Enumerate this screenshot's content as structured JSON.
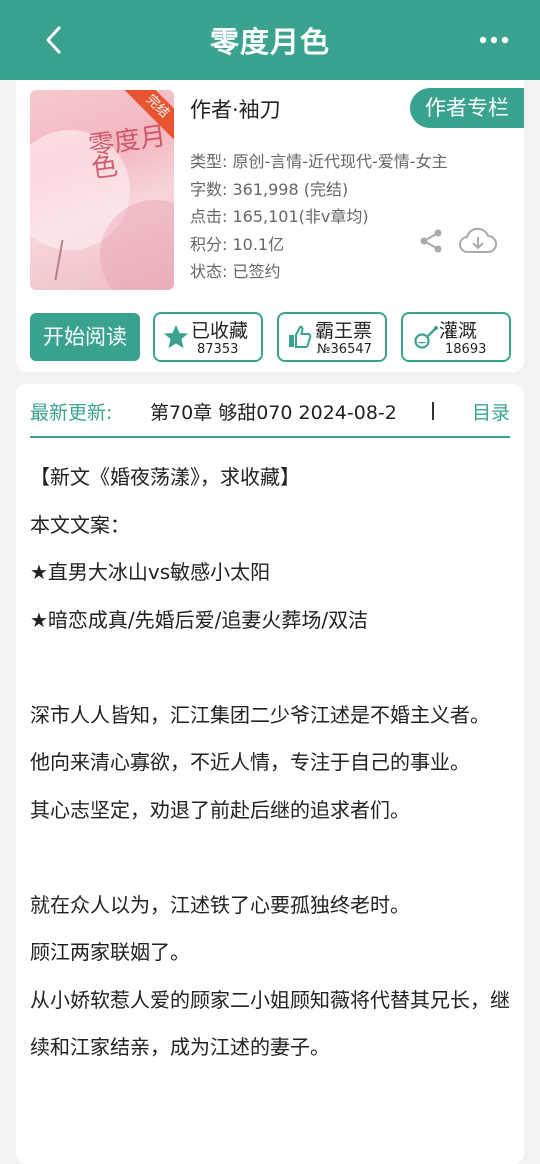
{
  "header": {
    "title": "零度月色",
    "back_icon": "chevron-left-icon",
    "more_icon": "more-horizontal-icon"
  },
  "book": {
    "cover_title_art": "零度月色",
    "status_badge": "完结",
    "author_line": "作者·袖刀",
    "author_column_button": "作者专栏",
    "info": {
      "type": "类型: 原创-言情-近代现代-爱情-女主",
      "words": "字数: 361,998 (完结)",
      "clicks": "点击: 165,101(非v章均)",
      "points": "积分: 10.1亿",
      "status": "状态: 已签约"
    },
    "share_icon": "share-icon",
    "download_icon": "cloud-download-icon"
  },
  "actions": {
    "read": "开始阅读",
    "favorite": {
      "label": "已收藏",
      "count": "87353",
      "icon": "star-icon"
    },
    "ticket": {
      "label": "霸王票",
      "count": "№36547",
      "icon": "thumbs-up-icon"
    },
    "water": {
      "label": "灌溉",
      "count": "18693",
      "icon": "watering-can-icon"
    }
  },
  "latest": {
    "label": "最新更新:",
    "chapter": "第70章  够甜070  2024-08-2",
    "toc": "目录"
  },
  "description": [
    "【新文《婚夜荡漾》，求收藏】",
    "本文文案：",
    "★直男大冰山vs敏感小太阳",
    "★暗恋成真/先婚后爱/追妻火葬场/双洁",
    "",
    "深市人人皆知，汇江集团二少爷江述是不婚主义者。",
    "他向来清心寡欲，不近人情，专注于自己的事业。",
    "其心志坚定，劝退了前赴后继的追求者们。",
    "",
    "就在众人以为，江述铁了心要孤独终老时。",
    "顾江两家联姻了。",
    "从小娇软惹人爱的顾家二小姐顾知薇将代替其兄长，继续和江家结亲，成为江述的妻子。"
  ],
  "colors": {
    "accent": "#3aa38f",
    "badge": "#e8542f",
    "background": "#f2f2f2"
  }
}
